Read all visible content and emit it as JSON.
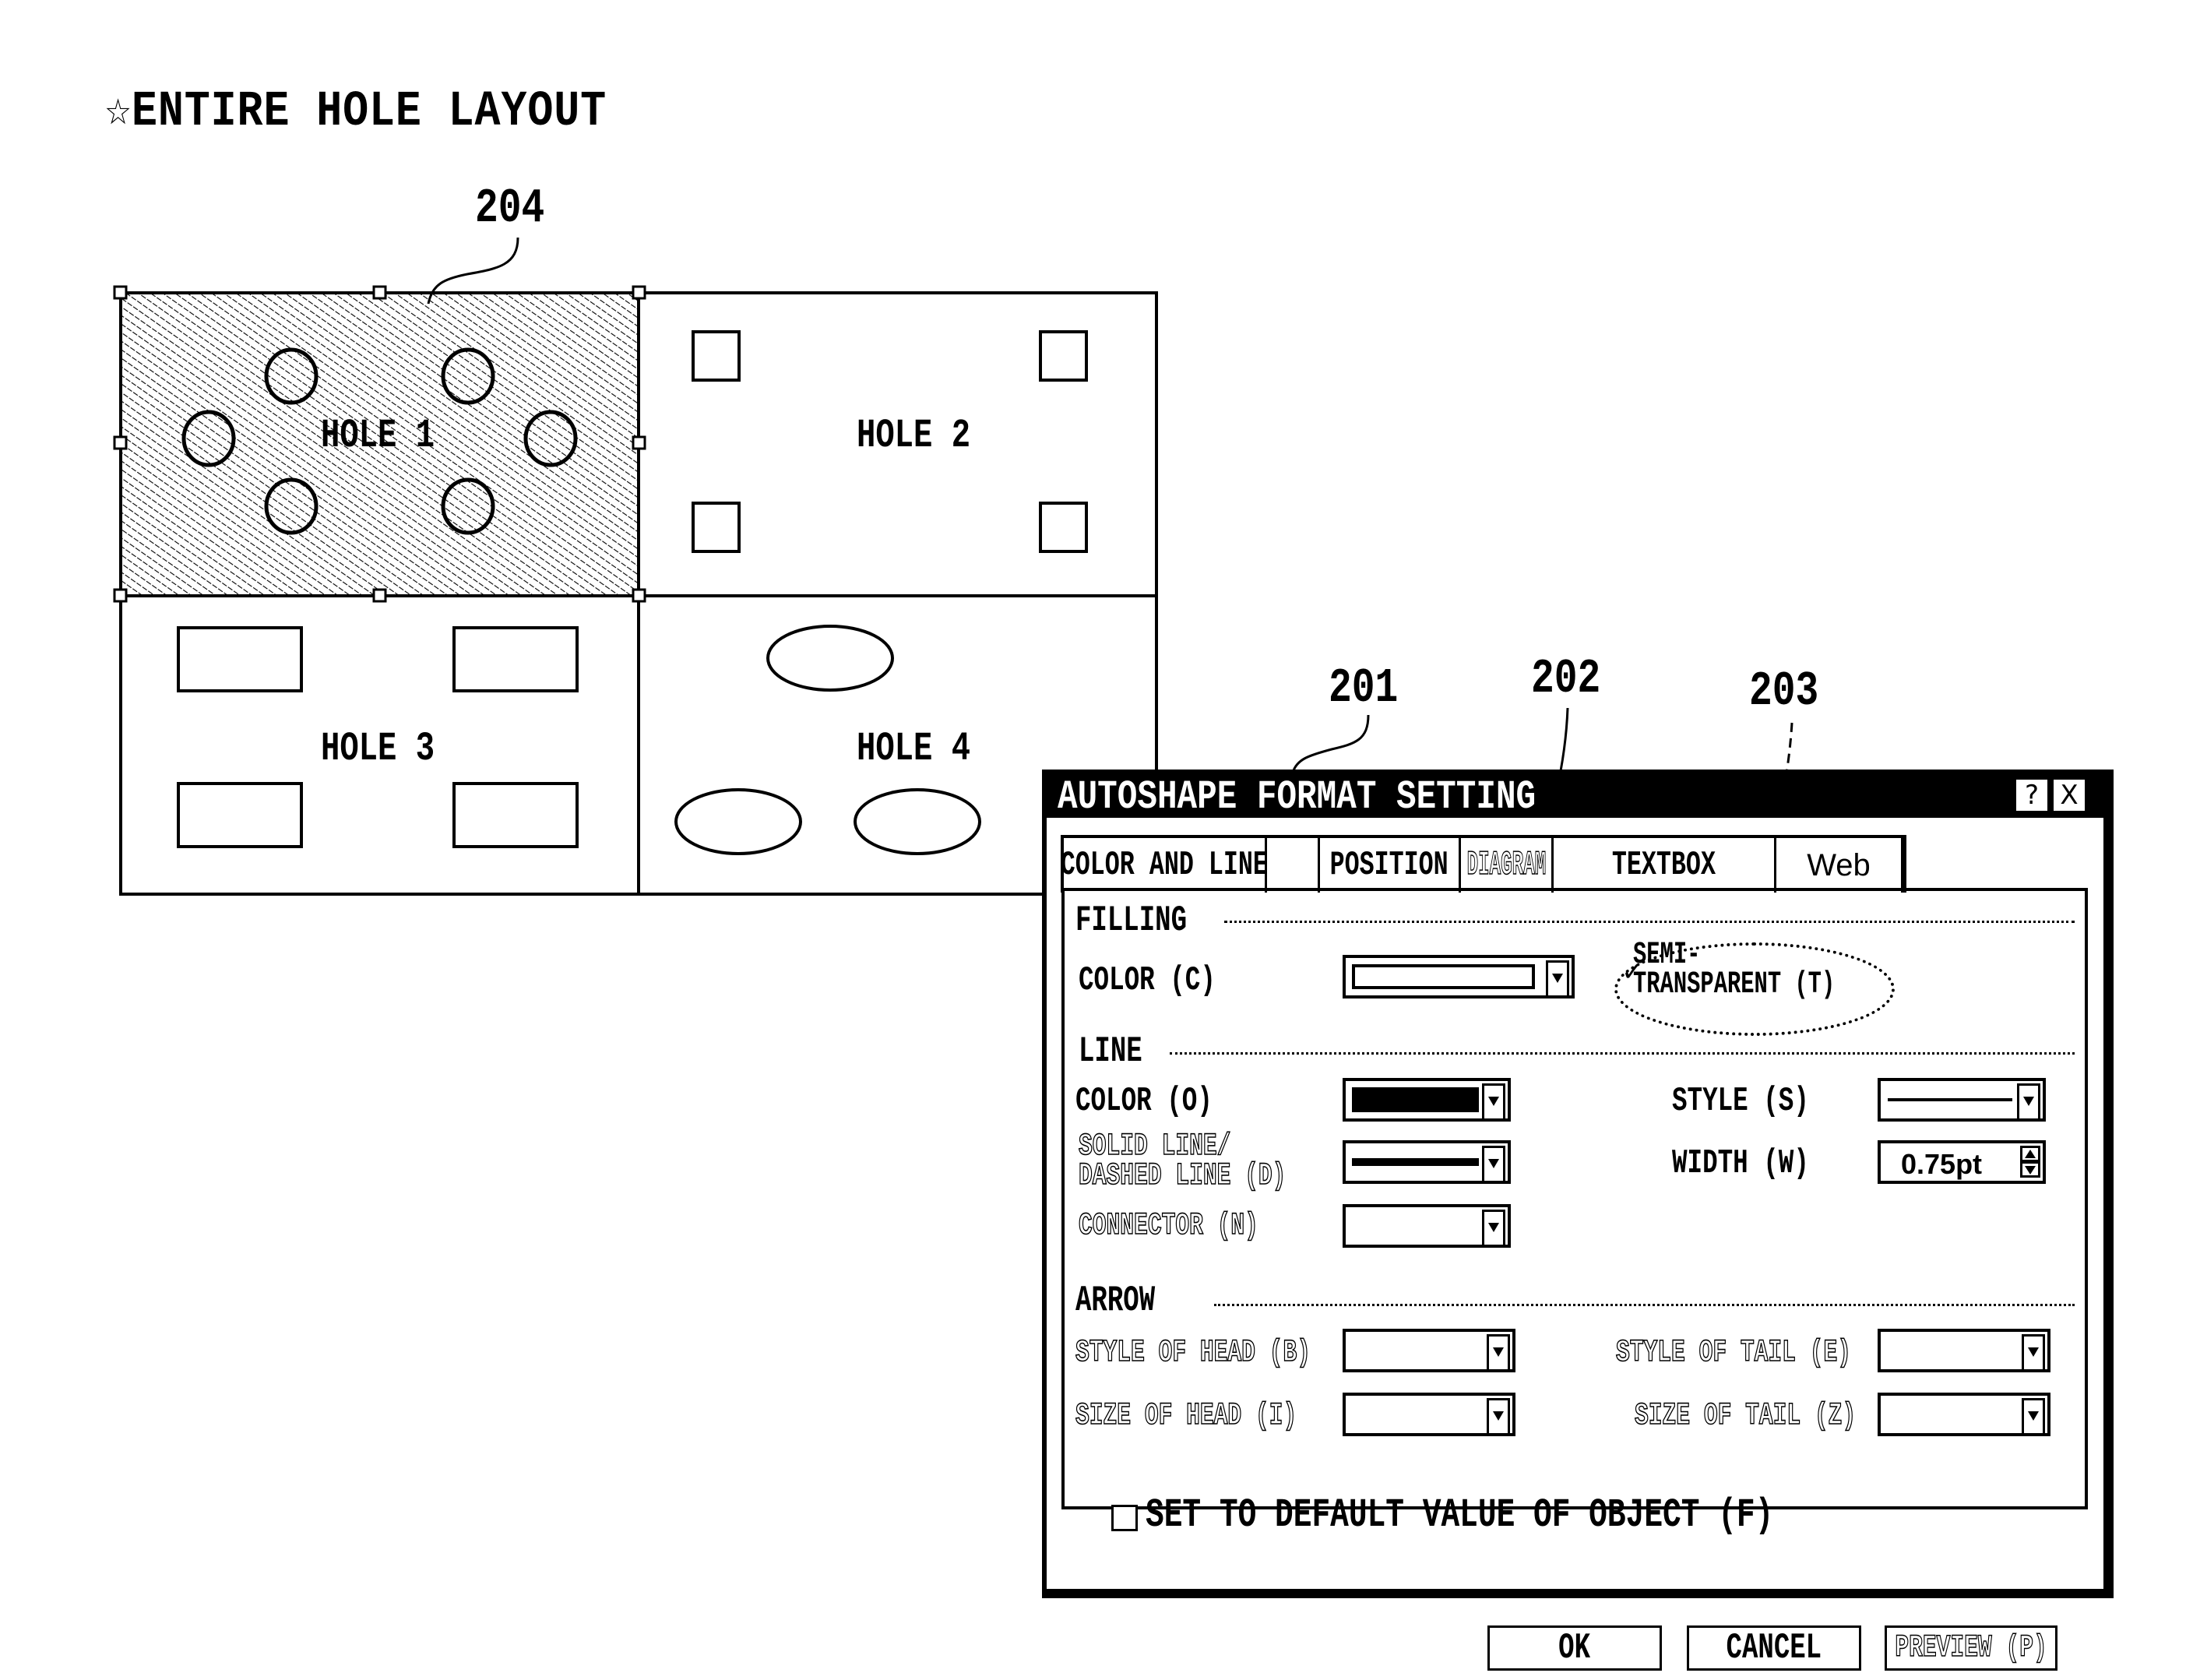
{
  "page": {
    "title": "☆ENTIRE HOLE LAYOUT",
    "reference_numbers": {
      "selected_hole": "204",
      "dialog": "201",
      "fill_color": "202",
      "semi_transparent": "203"
    }
  },
  "holes": [
    {
      "label": "HOLE 1",
      "selected": true,
      "fill": "hatched",
      "hole_shape": "circle",
      "hole_count": 6
    },
    {
      "label": "HOLE 2",
      "selected": false,
      "fill": "none",
      "hole_shape": "square",
      "hole_count": 4
    },
    {
      "label": "HOLE 3",
      "selected": false,
      "fill": "none",
      "hole_shape": "rectangle",
      "hole_count": 4
    },
    {
      "label": "HOLE 4",
      "selected": false,
      "fill": "none",
      "hole_shape": "ellipse",
      "hole_count": 3
    }
  ],
  "dialog": {
    "title": "AUTOSHAPE FORMAT SETTING",
    "help_icon": "?",
    "close_icon": "X",
    "tabs": [
      {
        "label": "COLOR AND LINE",
        "enabled": true
      },
      {
        "label": "",
        "enabled": true
      },
      {
        "label": "POSITION",
        "enabled": true
      },
      {
        "label": "DIAGRAM",
        "enabled": false
      },
      {
        "label": "TEXTBOX",
        "enabled": true
      },
      {
        "label": "Web",
        "enabled": true
      }
    ],
    "filling": {
      "section_label": "FILLING",
      "color_label": "COLOR (C)",
      "color_value": "white",
      "semi_transparent_label_line1": "SEMI-",
      "semi_transparent_label_line2": "TRANSPARENT (T)",
      "semi_transparent_checked": true,
      "check_mark": "✓"
    },
    "line": {
      "section_label": "LINE",
      "color_label": "COLOR (O)",
      "color_value": "black",
      "dash_label_line1": "SOLID LINE/",
      "dash_label_line2": "DASHED LINE (D)",
      "dash_value": "solid",
      "connector_label": "CONNECTOR (N)",
      "style_label": "STYLE (S)",
      "style_value": "single line",
      "width_label": "WIDTH (W)",
      "width_value": "0.75pt"
    },
    "arrow": {
      "section_label": "ARROW",
      "style_head_label": "STYLE OF HEAD (B)",
      "size_head_label": "SIZE OF HEAD (I)",
      "style_tail_label": "STYLE OF TAIL (E)",
      "size_tail_label": "SIZE OF TAIL (Z)"
    },
    "default_checkbox": {
      "label": "SET TO DEFAULT VALUE OF OBJECT (F)",
      "checked": false
    },
    "buttons": {
      "ok": "OK",
      "cancel": "CANCEL",
      "preview": "PREVIEW (P)"
    }
  }
}
